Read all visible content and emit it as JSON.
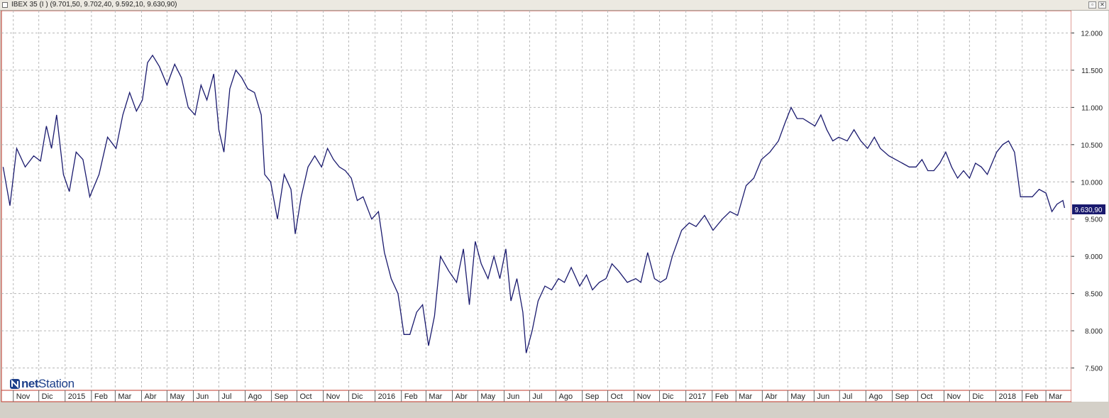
{
  "window": {
    "title": "IBEX 35 (I ) (9.701,50, 9.702,40, 9.592,10, 9.630,90)"
  },
  "logo": {
    "part1": "net",
    "part2": "Station"
  },
  "colors": {
    "line": "#1a1a6e",
    "grid": "#b8b8b8",
    "plot_bg": "#ffffff",
    "border": "#c0392b",
    "marker": "#f0e060"
  },
  "chart_data": {
    "type": "line",
    "title": "",
    "xlabel": "",
    "ylabel": "",
    "ylim": [
      7200,
      12300
    ],
    "y_ticks": [
      "7.500",
      "8.000",
      "8.500",
      "9.000",
      "9.500",
      "10.000",
      "10.500",
      "11.000",
      "11.500",
      "12.000"
    ],
    "y_tick_values": [
      7500,
      8000,
      8500,
      9000,
      9500,
      10000,
      10500,
      11000,
      11500,
      12000
    ],
    "last_value_label": "9.630,90",
    "last_value": 9630.9,
    "grid": true,
    "months": [
      "Nov",
      "Dic",
      "2015",
      "Feb",
      "Mar",
      "Abr",
      "May",
      "Jun",
      "Jul",
      "Ago",
      "Sep",
      "Oct",
      "Nov",
      "Dic",
      "2016",
      "Feb",
      "Mar",
      "Abr",
      "May",
      "Jun",
      "Jul",
      "Ago",
      "Sep",
      "Oct",
      "Nov",
      "Dic",
      "2017",
      "Feb",
      "Mar",
      "Abr",
      "May",
      "Jun",
      "Jul",
      "Ago",
      "Sep",
      "Oct",
      "Nov",
      "Dic",
      "2018",
      "Feb",
      "Mar"
    ],
    "series": [
      {
        "x": [
          "2014-10-20",
          "2014-10-28",
          "2014-11-05",
          "2014-11-15",
          "2014-11-25",
          "2014-12-03",
          "2014-12-10",
          "2014-12-16",
          "2014-12-22",
          "2014-12-30",
          "2015-01-06",
          "2015-01-14",
          "2015-01-22",
          "2015-01-30",
          "2015-02-10",
          "2015-02-20",
          "2015-03-02",
          "2015-03-10",
          "2015-03-18",
          "2015-03-26",
          "2015-04-02",
          "2015-04-08",
          "2015-04-14",
          "2015-04-22",
          "2015-05-01",
          "2015-05-10",
          "2015-05-18",
          "2015-05-26",
          "2015-06-03",
          "2015-06-10",
          "2015-06-17",
          "2015-06-25",
          "2015-07-01",
          "2015-07-07",
          "2015-07-14",
          "2015-07-21",
          "2015-07-28",
          "2015-08-04",
          "2015-08-12",
          "2015-08-20",
          "2015-08-24",
          "2015-08-31",
          "2015-09-08",
          "2015-09-16",
          "2015-09-24",
          "2015-09-29",
          "2015-10-06",
          "2015-10-14",
          "2015-10-22",
          "2015-10-30",
          "2015-11-06",
          "2015-11-13",
          "2015-11-20",
          "2015-11-27",
          "2015-12-04",
          "2015-12-11",
          "2015-12-18",
          "2015-12-28",
          "2016-01-05",
          "2016-01-12",
          "2016-01-20",
          "2016-01-28",
          "2016-02-04",
          "2016-02-11",
          "2016-02-19",
          "2016-02-26",
          "2016-03-04",
          "2016-03-11",
          "2016-03-18",
          "2016-03-28",
          "2016-04-06",
          "2016-04-14",
          "2016-04-21",
          "2016-04-28",
          "2016-05-05",
          "2016-05-13",
          "2016-05-20",
          "2016-05-27",
          "2016-06-03",
          "2016-06-09",
          "2016-06-16",
          "2016-06-23",
          "2016-06-27",
          "2016-07-04",
          "2016-07-11",
          "2016-07-19",
          "2016-07-27",
          "2016-08-04",
          "2016-08-11",
          "2016-08-19",
          "2016-08-29",
          "2016-09-06",
          "2016-09-13",
          "2016-09-21",
          "2016-09-29",
          "2016-10-06",
          "2016-10-14",
          "2016-10-24",
          "2016-11-03",
          "2016-11-09",
          "2016-11-17",
          "2016-11-25",
          "2016-12-02",
          "2016-12-09",
          "2016-12-16",
          "2016-12-27",
          "2017-01-05",
          "2017-01-13",
          "2017-01-23",
          "2017-02-02",
          "2017-02-13",
          "2017-02-22",
          "2017-03-03",
          "2017-03-13",
          "2017-03-22",
          "2017-03-31",
          "2017-04-10",
          "2017-04-20",
          "2017-04-28",
          "2017-05-05",
          "2017-05-12",
          "2017-05-19",
          "2017-05-26",
          "2017-06-02",
          "2017-06-09",
          "2017-06-16",
          "2017-06-23",
          "2017-06-30",
          "2017-07-10",
          "2017-07-18",
          "2017-07-26",
          "2017-08-03",
          "2017-08-11",
          "2017-08-18",
          "2017-08-28",
          "2017-09-05",
          "2017-09-13",
          "2017-09-21",
          "2017-09-29",
          "2017-10-06",
          "2017-10-13",
          "2017-10-20",
          "2017-10-27",
          "2017-11-03",
          "2017-11-10",
          "2017-11-17",
          "2017-11-24",
          "2017-12-01",
          "2017-12-08",
          "2017-12-15",
          "2017-12-22",
          "2018-01-02",
          "2018-01-09",
          "2018-01-16",
          "2018-01-23",
          "2018-01-30",
          "2018-02-06",
          "2018-02-13",
          "2018-02-21",
          "2018-03-01",
          "2018-03-08",
          "2018-03-14",
          "2018-03-21",
          "2018-03-23"
        ],
        "values": [
          10200,
          9680,
          10450,
          10200,
          10350,
          10280,
          10750,
          10450,
          10900,
          10100,
          9870,
          10400,
          10300,
          9800,
          10100,
          10600,
          10450,
          10900,
          11200,
          10950,
          11100,
          11600,
          11700,
          11550,
          11300,
          11580,
          11400,
          11000,
          10900,
          11300,
          11100,
          11450,
          10700,
          10400,
          11250,
          11500,
          11400,
          11250,
          11200,
          10900,
          10100,
          10000,
          9500,
          10100,
          9900,
          9300,
          9800,
          10200,
          10350,
          10200,
          10450,
          10300,
          10200,
          10150,
          10050,
          9750,
          9800,
          9500,
          9600,
          9050,
          8700,
          8500,
          7950,
          7950,
          8250,
          8350,
          7800,
          8200,
          9000,
          8800,
          8650,
          9100,
          8350,
          9200,
          8900,
          8700,
          9000,
          8700,
          9100,
          8400,
          8700,
          8250,
          7700,
          8000,
          8400,
          8600,
          8550,
          8700,
          8650,
          8850,
          8600,
          8750,
          8550,
          8650,
          8700,
          8900,
          8800,
          8650,
          8700,
          8650,
          9050,
          8700,
          8650,
          8700,
          9000,
          9350,
          9450,
          9400,
          9550,
          9350,
          9500,
          9600,
          9550,
          9950,
          10050,
          10300,
          10400,
          10550,
          10800,
          11000,
          10850,
          10850,
          10800,
          10750,
          10900,
          10700,
          10550,
          10600,
          10550,
          10700,
          10550,
          10450,
          10600,
          10450,
          10350,
          10300,
          10250,
          10200,
          10200,
          10300,
          10150,
          10150,
          10250,
          10400,
          10200,
          10050,
          10150,
          10050,
          10250,
          10200,
          10100,
          10400,
          10500,
          10550,
          10400,
          9800,
          9800,
          9800,
          9900,
          9850,
          9600,
          9700,
          9750,
          9650
        ]
      }
    ]
  }
}
